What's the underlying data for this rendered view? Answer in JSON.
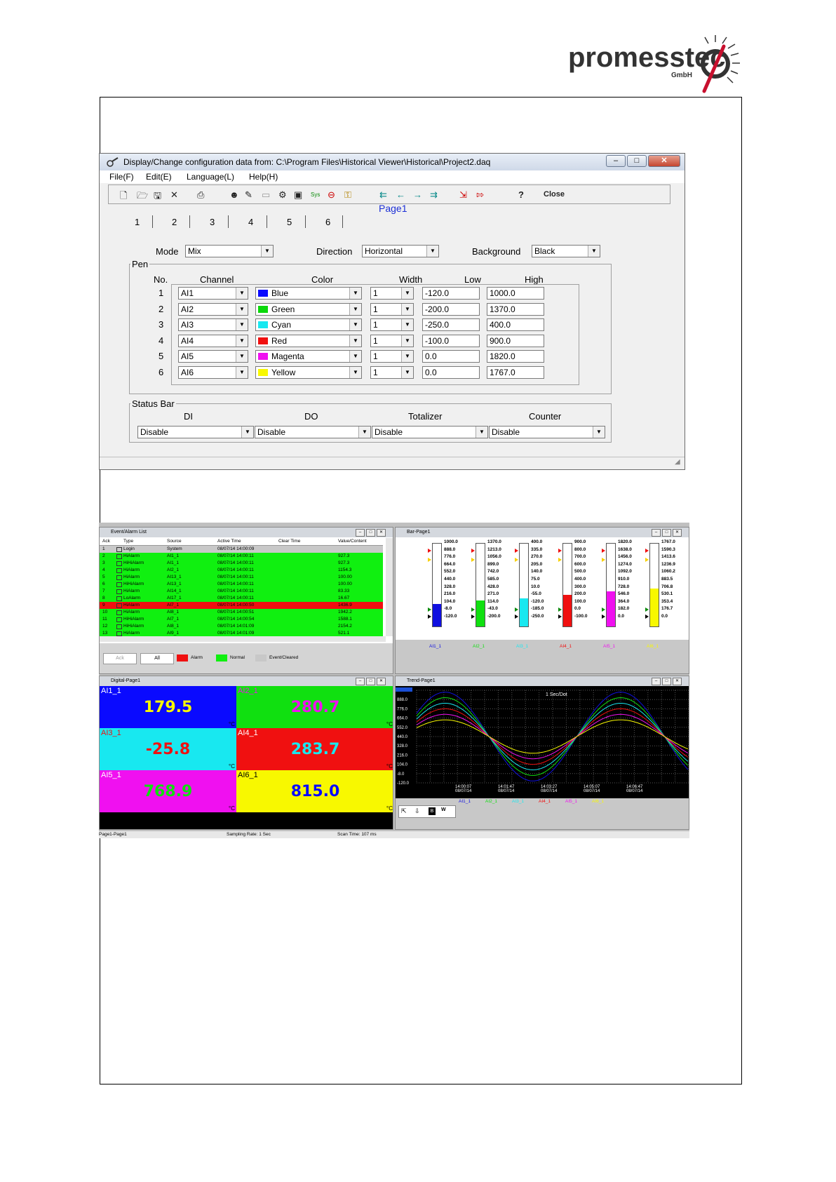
{
  "logo": {
    "name": "promesstec",
    "suffix": "GmbH"
  },
  "dialog": {
    "title": "Display/Change configuration data from: C:\\Program Files\\Historical Viewer\\Historical\\Project2.daq",
    "menu": [
      "File(F)",
      "Edit(E)",
      "Language(L)",
      "Help(H)"
    ],
    "toolbar": {
      "help": "?",
      "close": "Close",
      "sys": "Sys"
    },
    "page_title": "Page1",
    "tabs": [
      "1",
      "2",
      "3",
      "4",
      "5",
      "6"
    ],
    "mode_label": "Mode",
    "mode_value": "Mix",
    "direction_label": "Direction",
    "direction_value": "Horizontal",
    "background_label": "Background",
    "background_value": "Black",
    "pen_group": "Pen",
    "pen_headers": [
      "No.",
      "Channel",
      "Color",
      "Width",
      "Low",
      "High"
    ],
    "pens": [
      {
        "no": "1",
        "channel": "AI1",
        "color": "Blue",
        "hex": "#0a0aff",
        "width": "1",
        "low": "-120.0",
        "high": "1000.0"
      },
      {
        "no": "2",
        "channel": "AI2",
        "color": "Green",
        "hex": "#0ad80a",
        "width": "1",
        "low": "-200.0",
        "high": "1370.0"
      },
      {
        "no": "3",
        "channel": "AI3",
        "color": "Cyan",
        "hex": "#18e8f0",
        "width": "1",
        "low": "-250.0",
        "high": "400.0"
      },
      {
        "no": "4",
        "channel": "AI4",
        "color": "Red",
        "hex": "#f01010",
        "width": "1",
        "low": "-100.0",
        "high": "900.0"
      },
      {
        "no": "5",
        "channel": "AI5",
        "color": "Magenta",
        "hex": "#f010f0",
        "width": "1",
        "low": "0.0",
        "high": "1820.0"
      },
      {
        "no": "6",
        "channel": "AI6",
        "color": "Yellow",
        "hex": "#f8f800",
        "width": "1",
        "low": "0.0",
        "high": "1767.0"
      }
    ],
    "status_group": "Status Bar",
    "status_headers": [
      "DI",
      "DO",
      "Totalizer",
      "Counter"
    ],
    "status_values": [
      "Disable",
      "Disable",
      "Disable",
      "Disable"
    ]
  },
  "monitor": {
    "event_title": "Event/Alarm List",
    "event_headers": [
      "Ack",
      "Type",
      "Source",
      "Active Time",
      "Clear Time",
      "Value/Content"
    ],
    "events": [
      {
        "ack": "1",
        "type": "Login",
        "source": "System",
        "active": "08/07/14 14:00:09",
        "value": "",
        "bg": "#c8c8c8"
      },
      {
        "ack": "2",
        "type": "HiAlarm",
        "source": "AI1_1",
        "active": "08/07/14 14:00:11",
        "value": "927.3",
        "bg": "#10f010"
      },
      {
        "ack": "3",
        "type": "HiHiAlarm",
        "source": "AI1_1",
        "active": "08/07/14 14:00:11",
        "value": "927.3",
        "bg": "#10f010"
      },
      {
        "ack": "4",
        "type": "HiAlarm",
        "source": "AI2_1",
        "active": "08/07/14 14:00:11",
        "value": "1154.3",
        "bg": "#10f010"
      },
      {
        "ack": "5",
        "type": "HiAlarm",
        "source": "AI13_1",
        "active": "08/07/14 14:00:11",
        "value": "100.00",
        "bg": "#10f010"
      },
      {
        "ack": "6",
        "type": "HiHiAlarm",
        "source": "AI13_1",
        "active": "08/07/14 14:00:11",
        "value": "100.00",
        "bg": "#10f010"
      },
      {
        "ack": "7",
        "type": "HiAlarm",
        "source": "AI14_1",
        "active": "08/07/14 14:00:11",
        "value": "83.33",
        "bg": "#10f010"
      },
      {
        "ack": "8",
        "type": "LoAlarm",
        "source": "AI17_1",
        "active": "08/07/14 14:00:11",
        "value": "16.67",
        "bg": "#10f010"
      },
      {
        "ack": "9",
        "type": "HiAlarm",
        "source": "AI7_1",
        "active": "08/07/14 14:00:50",
        "value": "1436.9",
        "bg": "#f01010"
      },
      {
        "ack": "10",
        "type": "HiAlarm",
        "source": "AI8_1",
        "active": "08/07/14 14:00:51",
        "value": "1942.2",
        "bg": "#10f010"
      },
      {
        "ack": "11",
        "type": "HiHiAlarm",
        "source": "AI7_1",
        "active": "08/07/14 14:00:54",
        "value": "1588.1",
        "bg": "#10f010"
      },
      {
        "ack": "12",
        "type": "HiHiAlarm",
        "source": "AI8_1",
        "active": "08/07/14 14:01:09",
        "value": "2154.2",
        "bg": "#10f010"
      },
      {
        "ack": "13",
        "type": "HiAlarm",
        "source": "AI9_1",
        "active": "08/07/14 14:01:09",
        "value": "521.1",
        "bg": "#10f010"
      }
    ],
    "event_buttons": [
      "Ack",
      "All"
    ],
    "event_legend": [
      "Alarm",
      "Normal",
      "Event/Cleared"
    ],
    "bar_title": "Bar-Page1",
    "bars": [
      {
        "name": "AI1_1",
        "hex": "#1010e0",
        "level": 0.27,
        "scale": [
          "1000.0",
          "888.0",
          "776.0",
          "664.0",
          "552.0",
          "440.0",
          "328.0",
          "216.0",
          "104.0",
          "-8.0",
          "-120.0"
        ]
      },
      {
        "name": "AI2_1",
        "hex": "#10e010",
        "level": 0.31,
        "scale": [
          "1370.0",
          "1213.0",
          "1056.0",
          "899.0",
          "742.0",
          "585.0",
          "428.0",
          "271.0",
          "114.0",
          "-43.0",
          "-200.0"
        ]
      },
      {
        "name": "AI3_1",
        "hex": "#18e8f0",
        "level": 0.34,
        "scale": [
          "400.0",
          "335.0",
          "270.0",
          "205.0",
          "140.0",
          "75.0",
          "10.0",
          "-55.0",
          "-120.0",
          "-185.0",
          "-250.0"
        ]
      },
      {
        "name": "AI4_1",
        "hex": "#f01010",
        "level": 0.38,
        "scale": [
          "900.0",
          "800.0",
          "700.0",
          "600.0",
          "500.0",
          "400.0",
          "300.0",
          "200.0",
          "100.0",
          "0.0",
          "-100.0"
        ]
      },
      {
        "name": "AI5_1",
        "hex": "#f010f0",
        "level": 0.42,
        "scale": [
          "1820.0",
          "1638.0",
          "1456.0",
          "1274.0",
          "1092.0",
          "910.0",
          "728.0",
          "546.0",
          "364.0",
          "182.0",
          "0.0"
        ]
      },
      {
        "name": "AI6_1",
        "hex": "#f8f800",
        "level": 0.46,
        "scale": [
          "1767.0",
          "1590.3",
          "1413.6",
          "1236.9",
          "1060.2",
          "883.5",
          "706.8",
          "530.1",
          "353.4",
          "176.7",
          "0.0"
        ]
      }
    ],
    "digital_title": "Digital-Page1",
    "digitals": [
      {
        "name": "AI1_1",
        "value": "179.5",
        "unit": "°C",
        "bg": "#0a0aff",
        "name_color": "#ffffff",
        "value_color": "#f8f800"
      },
      {
        "name": "AI2_1",
        "value": "280.7",
        "unit": "°C",
        "bg": "#10e010",
        "name_color": "#f010f0",
        "value_color": "#f010f0"
      },
      {
        "name": "AI3_1",
        "value": "-25.8",
        "unit": "°C",
        "bg": "#18e8f0",
        "name_color": "#f01010",
        "value_color": "#f01010"
      },
      {
        "name": "AI4_1",
        "value": "283.7",
        "unit": "°C",
        "bg": "#f01010",
        "name_color": "#ffffff",
        "value_color": "#18e8f0"
      },
      {
        "name": "AI5_1",
        "value": "768.9",
        "unit": "°C",
        "bg": "#f010f0",
        "name_color": "#ffffff",
        "value_color": "#10e010"
      },
      {
        "name": "AI6_1",
        "value": "815.0",
        "unit": "°C",
        "bg": "#f8f800",
        "name_color": "#000000",
        "value_color": "#0a0aff"
      }
    ],
    "trend_title": "Trend-Page1",
    "trend_caption": "1 Sec/Dot",
    "trend_yticks": [
      "1000.0",
      "888.0",
      "776.0",
      "664.0",
      "552.0",
      "440.0",
      "328.0",
      "216.0",
      "104.0",
      "-8.0",
      "-120.0"
    ],
    "trend_xticks": [
      {
        "t": "14:00:07",
        "d": "08/07/14"
      },
      {
        "t": "14:01:47",
        "d": "08/07/14"
      },
      {
        "t": "14:03:27",
        "d": "08/07/14"
      },
      {
        "t": "14:05:07",
        "d": "08/07/14"
      },
      {
        "t": "14:06:47",
        "d": "08/07/14"
      }
    ],
    "trend_legend": [
      "AI1_1",
      "AI2_1",
      "AI3_1",
      "AI4_1",
      "AI5_1",
      "AI6_1"
    ],
    "trend_buttons": [
      "B",
      "W"
    ],
    "status": [
      "Page1-Page1",
      "Sampling Rate: 1 Sec",
      "Scan Time: 107 ms"
    ]
  }
}
